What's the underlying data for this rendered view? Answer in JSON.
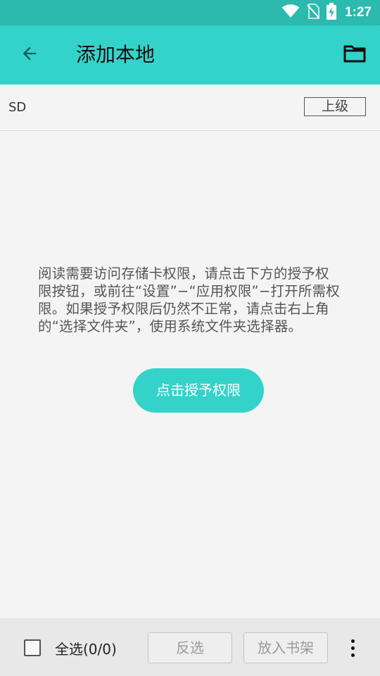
{
  "status_bar": {
    "time": "1:27",
    "icons": [
      "wifi-icon",
      "no-sim-icon",
      "battery-charging-icon"
    ]
  },
  "app_bar": {
    "title": "添加本地",
    "back_icon": "arrow-left-icon",
    "folder_icon": "folder-icon"
  },
  "path_bar": {
    "path": "SD",
    "up_label": "上级"
  },
  "main": {
    "message": "阅读需要访问存储卡权限，请点击下方的授予权限按钮，或前往“设置”−“应用权限”−打开所需权限。如果授予权限后仍然不正常，请点击右上角的“选择文件夹”，使用系统文件夹选择器。",
    "grant_button": "点击授予权限"
  },
  "bottom_bar": {
    "select_all_label": "全选(0/0)",
    "select_all_checked": false,
    "invert_label": "反选",
    "add_to_shelf_label": "放入书架",
    "more_icon": "more-vertical-icon"
  },
  "colors": {
    "status_bar": "#2cb9ae",
    "accent": "#34d3c9",
    "background": "#f4f4f4",
    "bottom_bar": "#e8e8e8"
  }
}
